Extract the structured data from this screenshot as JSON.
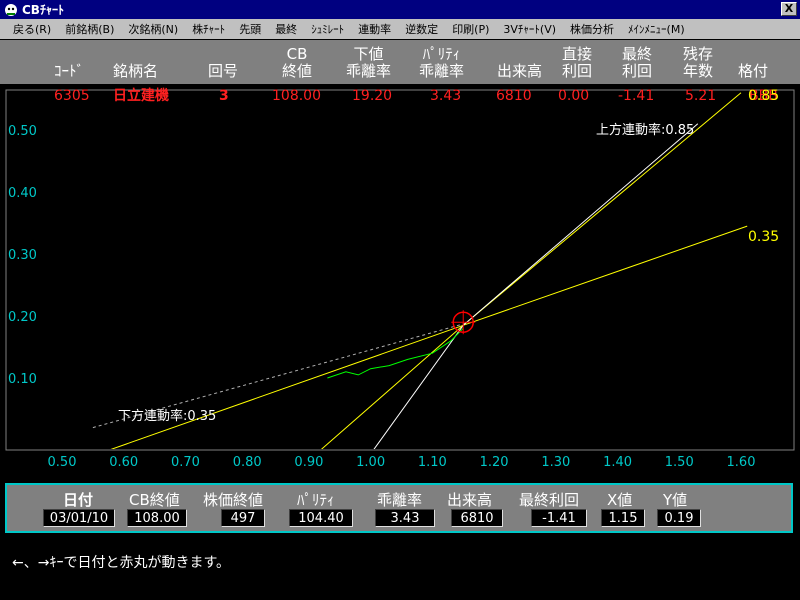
{
  "window": {
    "title": "CBﾁｬｰﾄ",
    "close_label": "X"
  },
  "menu": [
    "戻る(R)",
    "前銘柄(B)",
    "次銘柄(N)",
    "株ﾁｬｰﾄ",
    "先頭",
    "最終",
    "ｼｭﾐﾚｰﾄ",
    "連動率",
    "逆数定",
    "印刷(P)",
    "3Vﾁｬｰﾄ(V)",
    "株価分析",
    "ﾒｲﾝﾒﾆｭｰ(M)"
  ],
  "header": {
    "code": "ｺｰﾄﾞ",
    "name": "銘柄名",
    "issue": "回号",
    "cb_close_1": "CB",
    "cb_close_2": "終値",
    "downside_1": "下値",
    "downside_2": "乖離率",
    "parity_1": "ﾊﾟﾘﾃｨ",
    "parity_2": "乖離率",
    "volume": "出来高",
    "direct_1": "直接",
    "direct_2": "利回",
    "final_1": "最終",
    "final_2": "利回",
    "remain_1": "残存",
    "remain_2": "年数",
    "rating": "格付"
  },
  "row": {
    "code": "6305",
    "name": "日立建機",
    "issue": "3",
    "cb_close": "108.00",
    "downside": "19.20",
    "parity_dev": "3.43",
    "volume": "6810",
    "direct_yield": "0.00",
    "final_yield": "-1.41",
    "remain_years": "5.21",
    "rating": "BBB"
  },
  "chart_data": {
    "type": "line",
    "x_ticks": [
      "0.50",
      "0.60",
      "0.70",
      "0.80",
      "0.90",
      "1.00",
      "1.10",
      "1.20",
      "1.30",
      "1.40",
      "1.50",
      "1.60"
    ],
    "y_ticks": [
      "0.10",
      "0.20",
      "0.30",
      "0.40",
      "0.50"
    ],
    "xlim": [
      0.5,
      1.6
    ],
    "ylim": [
      0.1,
      0.5
    ],
    "grid": false,
    "annotations": {
      "upper": "上方連動率:0.85",
      "lower": "下方連動率:0.35",
      "label_085": "0.85",
      "label_035": "0.35"
    },
    "series": [
      {
        "values": [
          [
            0.48,
            -0.05
          ],
          [
            1.15,
            0.185
          ],
          [
            1.61,
            0.345
          ]
        ],
        "color": "#ffff00"
      },
      {
        "values": [
          [
            0.88,
            -0.05
          ],
          [
            1.15,
            0.185
          ],
          [
            1.6,
            0.56
          ]
        ],
        "color": "#ffff00"
      },
      {
        "values": [
          [
            0.98,
            -0.05
          ],
          [
            1.15,
            0.185
          ],
          [
            1.53,
            0.51
          ]
        ],
        "color": "#ffffff"
      },
      {
        "values": [
          [
            0.93,
            0.1
          ],
          [
            0.96,
            0.11
          ],
          [
            0.98,
            0.105
          ],
          [
            1.0,
            0.115
          ],
          [
            1.03,
            0.12
          ],
          [
            1.06,
            0.13
          ],
          [
            1.1,
            0.14
          ],
          [
            1.13,
            0.16
          ],
          [
            1.15,
            0.18
          ]
        ],
        "color": "#00ff00"
      }
    ],
    "dashed": {
      "values": [
        [
          0.55,
          0.02
        ],
        [
          1.16,
          0.19
        ]
      ],
      "color": "#b0b0b0"
    },
    "marker": {
      "x": 1.15,
      "y": 0.19,
      "color": "#ff0000"
    },
    "axis_color": "#00c8c8"
  },
  "info": {
    "date_label": "日付",
    "date_value": "03/01/10",
    "cb_label": "CB終値",
    "cb_value": "108.00",
    "stock_label": "株価終値",
    "stock_value": "497",
    "parity_label": "ﾊﾟﾘﾃｨ",
    "parity_value": "104.40",
    "dev_label": "乖離率",
    "dev_value": "3.43",
    "vol_label": "出来高",
    "vol_value": "6810",
    "yield_label": "最終利回",
    "yield_value": "-1.41",
    "x_label": "X値",
    "x_value": "1.15",
    "y_label": "Y値",
    "y_value": "0.19"
  },
  "footer": "←、→ｷｰで日付と赤丸が動きます。"
}
